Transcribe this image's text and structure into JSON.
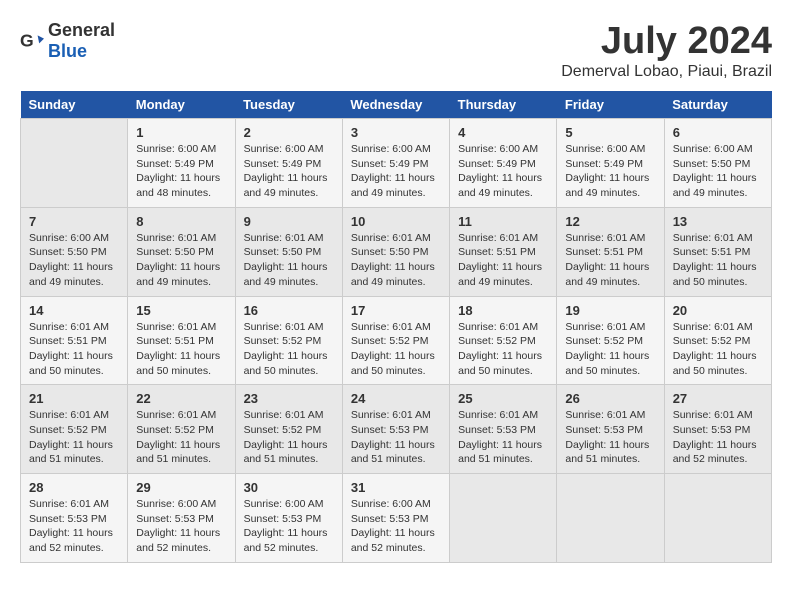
{
  "logo": {
    "general": "General",
    "blue": "Blue"
  },
  "title": "July 2024",
  "subtitle": "Demerval Lobao, Piaui, Brazil",
  "headers": [
    "Sunday",
    "Monday",
    "Tuesday",
    "Wednesday",
    "Thursday",
    "Friday",
    "Saturday"
  ],
  "weeks": [
    [
      {
        "day": "",
        "info": ""
      },
      {
        "day": "1",
        "info": "Sunrise: 6:00 AM\nSunset: 5:49 PM\nDaylight: 11 hours\nand 48 minutes."
      },
      {
        "day": "2",
        "info": "Sunrise: 6:00 AM\nSunset: 5:49 PM\nDaylight: 11 hours\nand 49 minutes."
      },
      {
        "day": "3",
        "info": "Sunrise: 6:00 AM\nSunset: 5:49 PM\nDaylight: 11 hours\nand 49 minutes."
      },
      {
        "day": "4",
        "info": "Sunrise: 6:00 AM\nSunset: 5:49 PM\nDaylight: 11 hours\nand 49 minutes."
      },
      {
        "day": "5",
        "info": "Sunrise: 6:00 AM\nSunset: 5:49 PM\nDaylight: 11 hours\nand 49 minutes."
      },
      {
        "day": "6",
        "info": "Sunrise: 6:00 AM\nSunset: 5:50 PM\nDaylight: 11 hours\nand 49 minutes."
      }
    ],
    [
      {
        "day": "7",
        "info": "Sunrise: 6:00 AM\nSunset: 5:50 PM\nDaylight: 11 hours\nand 49 minutes."
      },
      {
        "day": "8",
        "info": "Sunrise: 6:01 AM\nSunset: 5:50 PM\nDaylight: 11 hours\nand 49 minutes."
      },
      {
        "day": "9",
        "info": "Sunrise: 6:01 AM\nSunset: 5:50 PM\nDaylight: 11 hours\nand 49 minutes."
      },
      {
        "day": "10",
        "info": "Sunrise: 6:01 AM\nSunset: 5:50 PM\nDaylight: 11 hours\nand 49 minutes."
      },
      {
        "day": "11",
        "info": "Sunrise: 6:01 AM\nSunset: 5:51 PM\nDaylight: 11 hours\nand 49 minutes."
      },
      {
        "day": "12",
        "info": "Sunrise: 6:01 AM\nSunset: 5:51 PM\nDaylight: 11 hours\nand 49 minutes."
      },
      {
        "day": "13",
        "info": "Sunrise: 6:01 AM\nSunset: 5:51 PM\nDaylight: 11 hours\nand 50 minutes."
      }
    ],
    [
      {
        "day": "14",
        "info": "Sunrise: 6:01 AM\nSunset: 5:51 PM\nDaylight: 11 hours\nand 50 minutes."
      },
      {
        "day": "15",
        "info": "Sunrise: 6:01 AM\nSunset: 5:51 PM\nDaylight: 11 hours\nand 50 minutes."
      },
      {
        "day": "16",
        "info": "Sunrise: 6:01 AM\nSunset: 5:52 PM\nDaylight: 11 hours\nand 50 minutes."
      },
      {
        "day": "17",
        "info": "Sunrise: 6:01 AM\nSunset: 5:52 PM\nDaylight: 11 hours\nand 50 minutes."
      },
      {
        "day": "18",
        "info": "Sunrise: 6:01 AM\nSunset: 5:52 PM\nDaylight: 11 hours\nand 50 minutes."
      },
      {
        "day": "19",
        "info": "Sunrise: 6:01 AM\nSunset: 5:52 PM\nDaylight: 11 hours\nand 50 minutes."
      },
      {
        "day": "20",
        "info": "Sunrise: 6:01 AM\nSunset: 5:52 PM\nDaylight: 11 hours\nand 50 minutes."
      }
    ],
    [
      {
        "day": "21",
        "info": "Sunrise: 6:01 AM\nSunset: 5:52 PM\nDaylight: 11 hours\nand 51 minutes."
      },
      {
        "day": "22",
        "info": "Sunrise: 6:01 AM\nSunset: 5:52 PM\nDaylight: 11 hours\nand 51 minutes."
      },
      {
        "day": "23",
        "info": "Sunrise: 6:01 AM\nSunset: 5:52 PM\nDaylight: 11 hours\nand 51 minutes."
      },
      {
        "day": "24",
        "info": "Sunrise: 6:01 AM\nSunset: 5:53 PM\nDaylight: 11 hours\nand 51 minutes."
      },
      {
        "day": "25",
        "info": "Sunrise: 6:01 AM\nSunset: 5:53 PM\nDaylight: 11 hours\nand 51 minutes."
      },
      {
        "day": "26",
        "info": "Sunrise: 6:01 AM\nSunset: 5:53 PM\nDaylight: 11 hours\nand 51 minutes."
      },
      {
        "day": "27",
        "info": "Sunrise: 6:01 AM\nSunset: 5:53 PM\nDaylight: 11 hours\nand 52 minutes."
      }
    ],
    [
      {
        "day": "28",
        "info": "Sunrise: 6:01 AM\nSunset: 5:53 PM\nDaylight: 11 hours\nand 52 minutes."
      },
      {
        "day": "29",
        "info": "Sunrise: 6:00 AM\nSunset: 5:53 PM\nDaylight: 11 hours\nand 52 minutes."
      },
      {
        "day": "30",
        "info": "Sunrise: 6:00 AM\nSunset: 5:53 PM\nDaylight: 11 hours\nand 52 minutes."
      },
      {
        "day": "31",
        "info": "Sunrise: 6:00 AM\nSunset: 5:53 PM\nDaylight: 11 hours\nand 52 minutes."
      },
      {
        "day": "",
        "info": ""
      },
      {
        "day": "",
        "info": ""
      },
      {
        "day": "",
        "info": ""
      }
    ]
  ]
}
